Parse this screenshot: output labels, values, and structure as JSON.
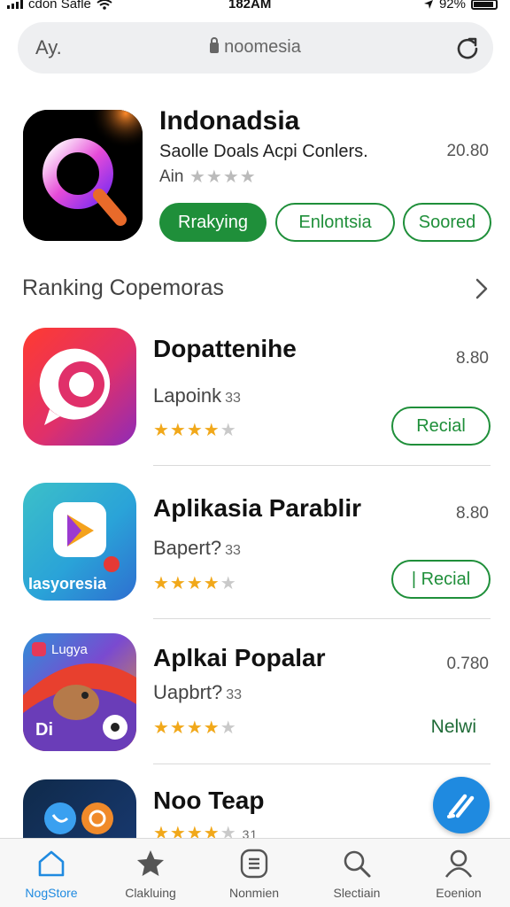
{
  "status_bar": {
    "carrier": "cdon Safle",
    "time": "182AM",
    "battery": "92%"
  },
  "search": {
    "left_label": "Ay.",
    "address": "noomesia",
    "reload_icon": "reload-icon",
    "lock_icon": "lock-icon"
  },
  "featured": {
    "title": "Indonadsia",
    "subtitle": "Saolle Doals Acpi Conlers.",
    "size": "20.80",
    "rating_label": "Ain",
    "stars": "★★★★",
    "buttons": [
      {
        "label": "Rrakying",
        "style": "primary"
      },
      {
        "label": "Enlontsia",
        "style": "outline"
      },
      {
        "label": "Soored",
        "style": "outline"
      }
    ],
    "colors": {
      "accent": "#1f8f3a"
    }
  },
  "section": {
    "title": "Ranking Copemoras",
    "chevron_icon": "chevron-right-icon"
  },
  "apps": [
    {
      "name": "Dopattenihe",
      "size": "8.80",
      "subtitle": "Lapoink",
      "count": "33",
      "rating": 4,
      "stars_on": "★★★★",
      "stars_off": "★",
      "action": "Recial",
      "action_style": "button"
    },
    {
      "name": "Aplikasia Parablir",
      "size": "8.80",
      "subtitle": "Bapert?",
      "count": "33",
      "rating": 4,
      "stars_on": "★★★★",
      "stars_off": "★",
      "action": "| Recial",
      "action_style": "button",
      "icon_label": "Iasyoresia"
    },
    {
      "name": "Aplkai Popalar",
      "size": "0.780",
      "subtitle": "Uapbrt?",
      "count": "33",
      "rating": 4,
      "stars_on": "★★★★",
      "stars_off": "★",
      "action": "Nelwi",
      "action_style": "text",
      "icon_label_top": "Lugya",
      "icon_label_bottom": "Di"
    },
    {
      "name": "Noo Teap",
      "subtitle": "",
      "count": "31",
      "rating": 4,
      "stars_on": "★★★★",
      "stars_off": "★"
    }
  ],
  "fab": {
    "icon": "pencil-icon",
    "color": "#1f8ae0"
  },
  "tabs": [
    {
      "label": "NogStore",
      "icon": "home-icon",
      "active": true
    },
    {
      "label": "Clakluing",
      "icon": "star-icon",
      "active": false
    },
    {
      "label": "Nonmien",
      "icon": "list-icon",
      "active": false
    },
    {
      "label": "Slectiain",
      "icon": "search-icon",
      "active": false
    },
    {
      "label": "Eoenion",
      "icon": "person-icon",
      "active": false
    }
  ]
}
